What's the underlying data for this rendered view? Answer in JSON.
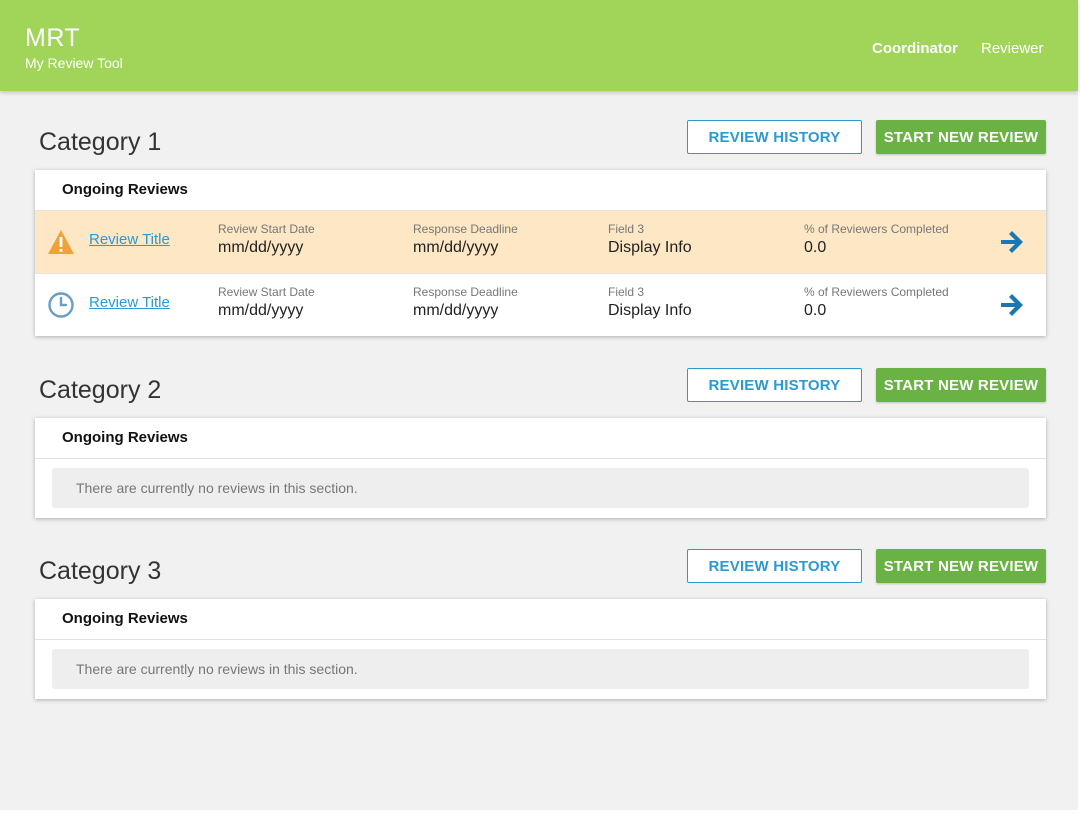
{
  "app": {
    "title": "MRT",
    "subtitle": "My Review Tool",
    "nav": {
      "coordinator": "Coordinator",
      "reviewer": "Reviewer"
    },
    "colors": {
      "header": "#a0d55a",
      "primary_button": "#6ab243",
      "link": "#2a9ad1",
      "warning_row": "#fde7c4"
    }
  },
  "categories": [
    {
      "title": "Category 1",
      "history_label": "REVIEW HISTORY",
      "new_label": "START NEW REVIEW",
      "panel_title": "Ongoing Reviews",
      "rows": [
        {
          "status_icon": "warning-icon",
          "title": "Review Title",
          "f1_label": "Review Start Date",
          "f1_value": "mm/dd/yyyy",
          "f2_label": "Response Deadline",
          "f2_value": "mm/dd/yyyy",
          "f3_label": "Field 3",
          "f3_value": "Display Info",
          "f4_label": "% of Reviewers Completed",
          "f4_value": "0.0"
        },
        {
          "status_icon": "clock-icon",
          "title": "Review Title",
          "f1_label": "Review Start Date",
          "f1_value": "mm/dd/yyyy",
          "f2_label": "Response Deadline",
          "f2_value": "mm/dd/yyyy",
          "f3_label": "Field 3",
          "f3_value": "Display Info",
          "f4_label": "% of Reviewers Completed",
          "f4_value": "0.0"
        }
      ]
    },
    {
      "title": "Category 2",
      "history_label": "REVIEW HISTORY",
      "new_label": "START NEW REVIEW",
      "panel_title": "Ongoing Reviews",
      "empty_text": "There are currently no reviews in this section."
    },
    {
      "title": "Category 3",
      "history_label": "REVIEW HISTORY",
      "new_label": "START NEW REVIEW",
      "panel_title": "Ongoing Reviews",
      "empty_text": "There are currently no reviews in this section."
    }
  ]
}
